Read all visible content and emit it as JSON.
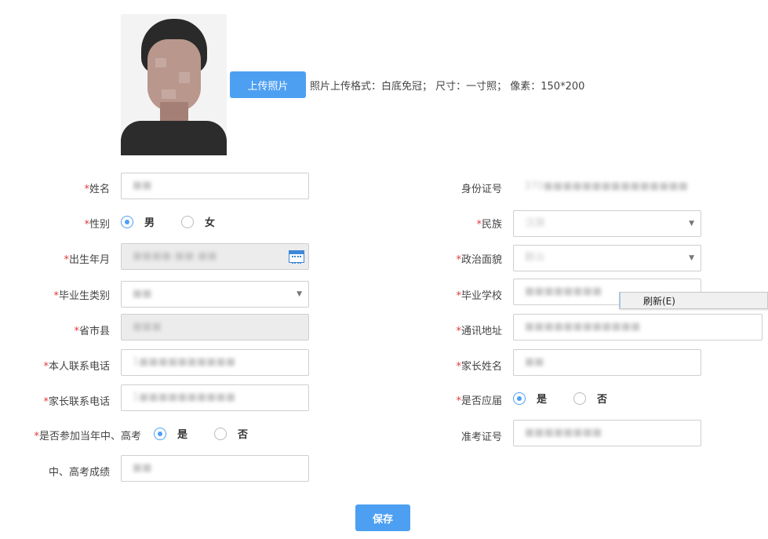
{
  "photo": {
    "icon": "user-photo"
  },
  "upload": {
    "button_label": "上传照片",
    "hint": "照片上传格式：白底免冠； 尺寸：一寸照； 像素：150*200"
  },
  "form": {
    "required_mark": "*",
    "name": {
      "label": "姓名",
      "value": "■■"
    },
    "id_number": {
      "label": "身份证号",
      "value": "370■■■■■■■■■■■■■■■"
    },
    "gender": {
      "label": "性别",
      "options": [
        "男",
        "女"
      ],
      "selected": "男"
    },
    "ethnicity": {
      "label": "民族",
      "value": "汉族"
    },
    "birth_date": {
      "label": "出生年月",
      "value": "■■■■-■■-■■"
    },
    "political_status": {
      "label": "政治面貌",
      "value": "群众"
    },
    "graduate_type": {
      "label": "毕业生类别",
      "value": "■■"
    },
    "school": {
      "label": "毕业学校",
      "value": "■■■■■■■■"
    },
    "province_city_county": {
      "label": "省市县",
      "value": "■■■"
    },
    "address": {
      "label": "通讯地址",
      "value": "■■■■■■■■■■■■"
    },
    "phone": {
      "label": "本人联系电话",
      "value": "1■■■■■■■■■■"
    },
    "parent_name": {
      "label": "家长姓名",
      "value": "■■"
    },
    "parent_phone": {
      "label": "家长联系电话",
      "value": "1■■■■■■■■■■"
    },
    "is_current": {
      "label": "是否应届",
      "options": [
        "是",
        "否"
      ],
      "selected": "是"
    },
    "took_exam": {
      "label": "是否参加当年中、高考",
      "options": [
        "是",
        "否"
      ],
      "selected": "是"
    },
    "exam_number": {
      "label": "准考证号",
      "value": "■■■■■■■■"
    },
    "exam_score": {
      "label": "中、高考成绩",
      "value": "■■"
    }
  },
  "context_menu": {
    "refresh_label": "刷新(E)"
  },
  "save_button_label": "保存",
  "colors": {
    "accent": "#4d9ff2",
    "required": "#e4393c"
  }
}
